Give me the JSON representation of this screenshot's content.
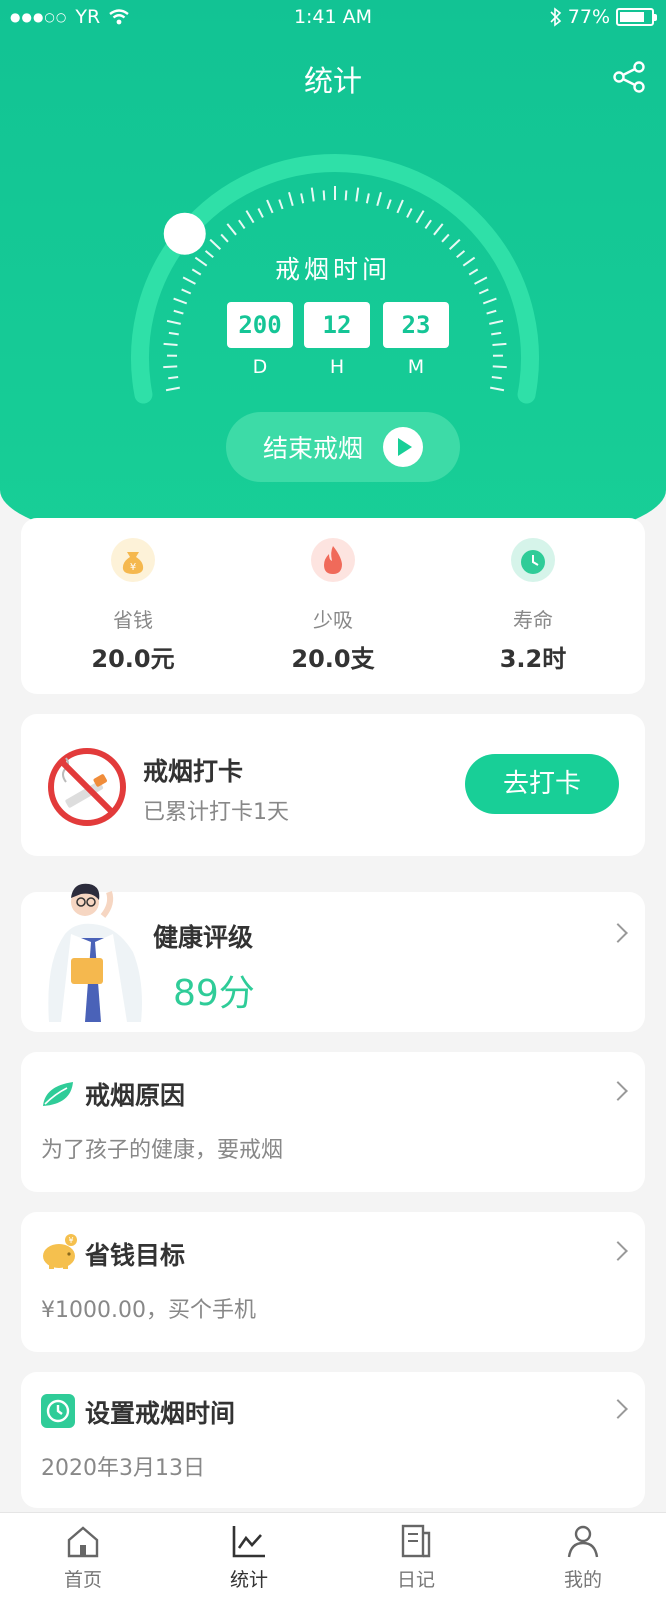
{
  "status": {
    "carrier": "YR",
    "time": "1:41 AM",
    "battery": "77%"
  },
  "header": {
    "title": "统计"
  },
  "timer": {
    "label": "戒烟时间",
    "days": "200",
    "hours": "12",
    "minutes": "23",
    "unit_d": "D",
    "unit_h": "H",
    "unit_m": "M",
    "end_button": "结束戒烟"
  },
  "stats": [
    {
      "label": "省钱",
      "value": "20.0元",
      "icon": "money-bag-icon",
      "color": "#f5b84e"
    },
    {
      "label": "少吸",
      "value": "20.0支",
      "icon": "flame-icon",
      "color": "#f06a5a"
    },
    {
      "label": "寿命",
      "value": "3.2时",
      "icon": "clock-icon",
      "color": "#2fcc98"
    }
  ],
  "checkin": {
    "title": "戒烟打卡",
    "subtitle": "已累计打卡1天",
    "button": "去打卡"
  },
  "health": {
    "title": "健康评级",
    "score": "89分"
  },
  "reason": {
    "title": "戒烟原因",
    "text": "为了孩子的健康，要戒烟"
  },
  "saving": {
    "title": "省钱目标",
    "text": "¥1000.00，买个手机"
  },
  "quit_time": {
    "title": "设置戒烟时间",
    "text": "2020年3月13日"
  },
  "tabs": [
    {
      "label": "首页"
    },
    {
      "label": "统计"
    },
    {
      "label": "日记"
    },
    {
      "label": "我的"
    }
  ],
  "colors": {
    "accent": "#18cf97",
    "accent_dark": "#12c394"
  }
}
